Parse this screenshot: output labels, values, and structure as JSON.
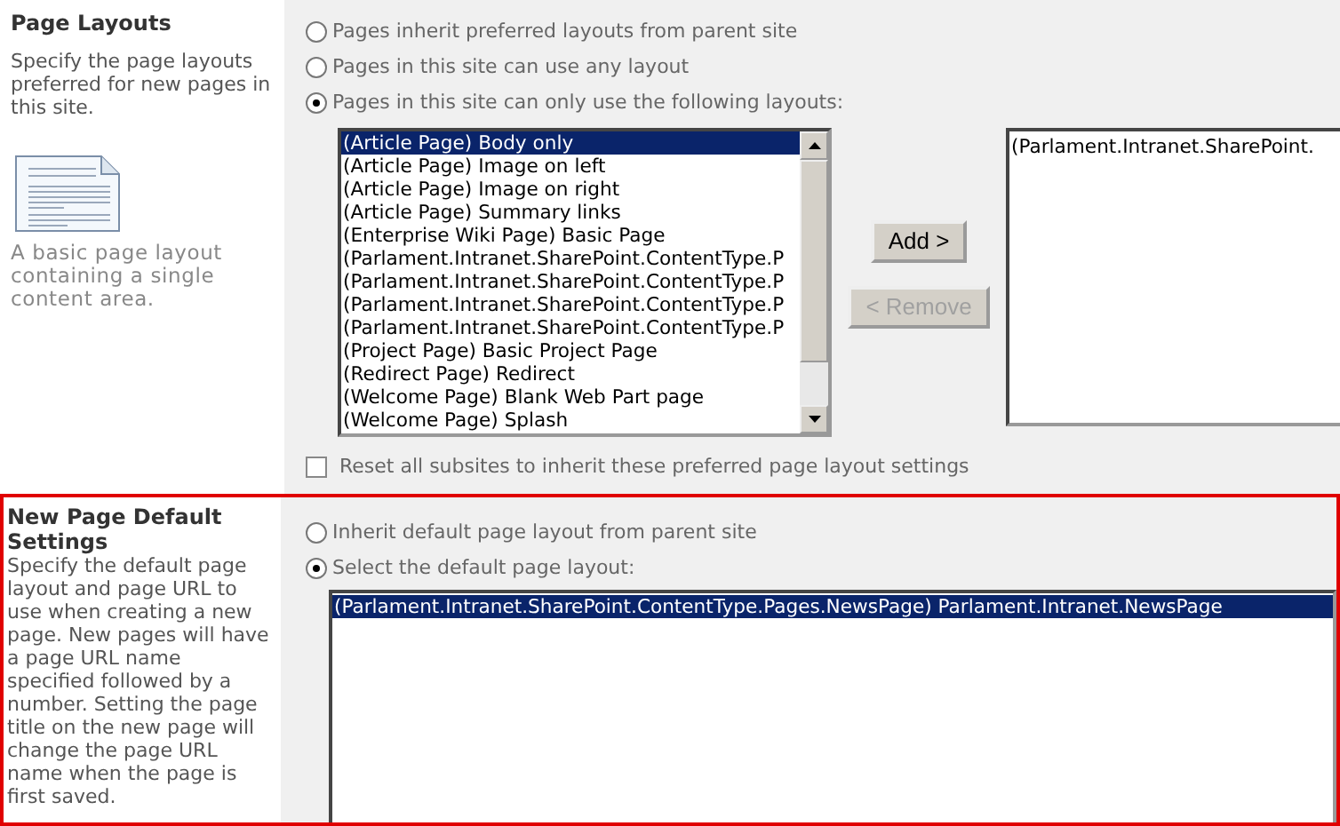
{
  "page_layouts": {
    "title": "Page Layouts",
    "description": "Specify the page layouts preferred for new pages in this site.",
    "preview_caption": "A basic page layout containing a single content area.",
    "options": [
      {
        "label": "Pages inherit preferred layouts from parent site",
        "selected": false
      },
      {
        "label": "Pages in this site can use any layout",
        "selected": false
      },
      {
        "label": "Pages in this site can only use the following layouts:",
        "selected": true
      }
    ],
    "available_layouts": [
      {
        "label": "(Article Page) Body only",
        "selected": true
      },
      {
        "label": "(Article Page) Image on left",
        "selected": false
      },
      {
        "label": "(Article Page) Image on right",
        "selected": false
      },
      {
        "label": "(Article Page) Summary links",
        "selected": false
      },
      {
        "label": "(Enterprise Wiki Page) Basic Page",
        "selected": false
      },
      {
        "label": "(Parlament.Intranet.SharePoint.ContentType.P",
        "selected": false
      },
      {
        "label": "(Parlament.Intranet.SharePoint.ContentType.P",
        "selected": false
      },
      {
        "label": "(Parlament.Intranet.SharePoint.ContentType.P",
        "selected": false
      },
      {
        "label": "(Parlament.Intranet.SharePoint.ContentType.P",
        "selected": false
      },
      {
        "label": "(Project Page) Basic Project Page",
        "selected": false
      },
      {
        "label": "(Redirect Page) Redirect",
        "selected": false
      },
      {
        "label": "(Welcome Page) Blank Web Part page",
        "selected": false
      },
      {
        "label": "(Welcome Page) Splash",
        "selected": false
      }
    ],
    "add_button": {
      "label": "Add >",
      "disabled": false
    },
    "remove_button": {
      "label": "< Remove",
      "disabled": true
    },
    "selected_layouts": [
      {
        "label": "(Parlament.Intranet.SharePoint.",
        "selected": false
      }
    ],
    "reset_checkbox": {
      "label": "Reset all subsites to inherit these preferred page layout settings",
      "checked": false
    }
  },
  "new_page_default": {
    "title": "New Page Default Settings",
    "description": "Specify the default page layout and page URL to use when creating a new page. New pages will have a page URL name specified followed by a number. Setting the page title on the new page will change the page URL name when the page is first saved.",
    "options": [
      {
        "label": "Inherit default page layout from parent site",
        "selected": false
      },
      {
        "label": "Select the default page layout:",
        "selected": true
      }
    ],
    "default_layouts": [
      {
        "label": "(Parlament.Intranet.SharePoint.ContentType.Pages.NewsPage) Parlament.Intranet.NewsPage",
        "selected": true
      }
    ]
  }
}
